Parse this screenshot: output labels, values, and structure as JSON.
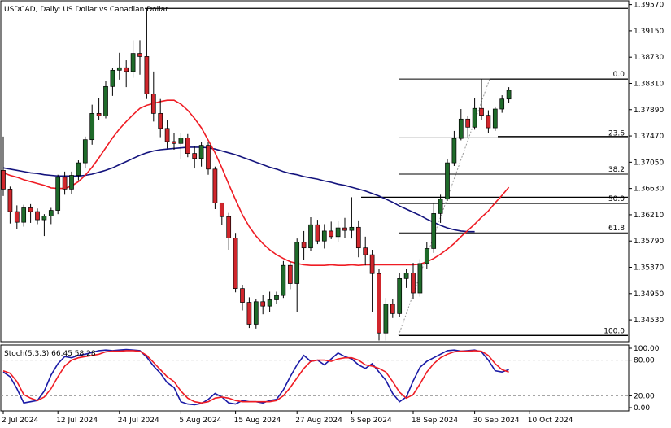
{
  "title": "USDCAD, Daily:  US Dollar vs Canadian Dollar",
  "indicator_title": "Stoch(5,3,3) 66.45 58.28",
  "colors": {
    "bull": "#1f6b2a",
    "bear": "#d0262c",
    "wick": "#000000",
    "ma_fast": "#ef1c24",
    "ma_slow": "#13137d",
    "stoch_main": "#1a1aa6",
    "stoch_signal": "#ef1c24",
    "fib": "#000000"
  },
  "chart_data": {
    "type": "candlestick",
    "symbol": "USDCAD",
    "timeframe": "Daily",
    "ylim": [
      1.3418,
      1.3963
    ],
    "y_ticks": [
      "1.39570",
      "1.39150",
      "1.38730",
      "1.38310",
      "1.37890",
      "1.37470",
      "1.37050",
      "1.36630",
      "1.36210",
      "1.35790",
      "1.35370",
      "1.34950",
      "1.34530"
    ],
    "x_tick_labels": [
      "2 Jul 2024",
      "12 Jul 2024",
      "24 Jul 2024",
      "5 Aug 2024",
      "15 Aug 2024",
      "27 Aug 2024",
      "6 Sep 2024",
      "18 Sep 2024",
      "30 Sep 2024",
      "10 Oct 2024"
    ],
    "candles": [
      {
        "o": 1.3692,
        "h": 1.3746,
        "l": 1.3651,
        "c": 1.3662
      },
      {
        "o": 1.3662,
        "h": 1.3666,
        "l": 1.3607,
        "c": 1.3626
      },
      {
        "o": 1.3626,
        "h": 1.3636,
        "l": 1.3598,
        "c": 1.3609
      },
      {
        "o": 1.3609,
        "h": 1.3637,
        "l": 1.3602,
        "c": 1.3632
      },
      {
        "o": 1.3632,
        "h": 1.3638,
        "l": 1.3608,
        "c": 1.3626
      },
      {
        "o": 1.3626,
        "h": 1.3631,
        "l": 1.3606,
        "c": 1.3613
      },
      {
        "o": 1.3613,
        "h": 1.3622,
        "l": 1.3587,
        "c": 1.3619
      },
      {
        "o": 1.3619,
        "h": 1.3632,
        "l": 1.3606,
        "c": 1.3628
      },
      {
        "o": 1.3628,
        "h": 1.3685,
        "l": 1.3622,
        "c": 1.3681
      },
      {
        "o": 1.3681,
        "h": 1.369,
        "l": 1.3653,
        "c": 1.3662
      },
      {
        "o": 1.3662,
        "h": 1.369,
        "l": 1.3654,
        "c": 1.3684
      },
      {
        "o": 1.3684,
        "h": 1.3708,
        "l": 1.3676,
        "c": 1.3704
      },
      {
        "o": 1.3704,
        "h": 1.3746,
        "l": 1.3695,
        "c": 1.3741
      },
      {
        "o": 1.3741,
        "h": 1.3797,
        "l": 1.3733,
        "c": 1.3783
      },
      {
        "o": 1.3783,
        "h": 1.3807,
        "l": 1.3772,
        "c": 1.3779
      },
      {
        "o": 1.3779,
        "h": 1.3835,
        "l": 1.3775,
        "c": 1.3826
      },
      {
        "o": 1.3826,
        "h": 1.3856,
        "l": 1.3811,
        "c": 1.3852
      },
      {
        "o": 1.3852,
        "h": 1.388,
        "l": 1.3837,
        "c": 1.3856
      },
      {
        "o": 1.3856,
        "h": 1.3868,
        "l": 1.3825,
        "c": 1.385
      },
      {
        "o": 1.385,
        "h": 1.39,
        "l": 1.384,
        "c": 1.3879
      },
      {
        "o": 1.3879,
        "h": 1.39,
        "l": 1.3845,
        "c": 1.3874
      },
      {
        "o": 1.3874,
        "h": 1.3951,
        "l": 1.3806,
        "c": 1.3814
      },
      {
        "o": 1.3814,
        "h": 1.385,
        "l": 1.377,
        "c": 1.3783
      },
      {
        "o": 1.3783,
        "h": 1.3806,
        "l": 1.3745,
        "c": 1.3759
      },
      {
        "o": 1.3759,
        "h": 1.3772,
        "l": 1.3727,
        "c": 1.3738
      },
      {
        "o": 1.3738,
        "h": 1.3751,
        "l": 1.3725,
        "c": 1.3735
      },
      {
        "o": 1.3735,
        "h": 1.3752,
        "l": 1.371,
        "c": 1.3744
      },
      {
        "o": 1.3744,
        "h": 1.375,
        "l": 1.3713,
        "c": 1.3719
      },
      {
        "o": 1.3719,
        "h": 1.373,
        "l": 1.3695,
        "c": 1.3711
      },
      {
        "o": 1.3711,
        "h": 1.3738,
        "l": 1.3698,
        "c": 1.3732
      },
      {
        "o": 1.3732,
        "h": 1.3737,
        "l": 1.3685,
        "c": 1.3694
      },
      {
        "o": 1.3694,
        "h": 1.3698,
        "l": 1.363,
        "c": 1.364
      },
      {
        "o": 1.364,
        "h": 1.364,
        "l": 1.3605,
        "c": 1.3618
      },
      {
        "o": 1.3618,
        "h": 1.3624,
        "l": 1.3565,
        "c": 1.3584
      },
      {
        "o": 1.3584,
        "h": 1.3592,
        "l": 1.3497,
        "c": 1.3503
      },
      {
        "o": 1.3503,
        "h": 1.3509,
        "l": 1.3468,
        "c": 1.3481
      },
      {
        "o": 1.3481,
        "h": 1.3489,
        "l": 1.344,
        "c": 1.3446
      },
      {
        "o": 1.3446,
        "h": 1.3486,
        "l": 1.3439,
        "c": 1.3482
      },
      {
        "o": 1.3482,
        "h": 1.3493,
        "l": 1.3462,
        "c": 1.3475
      },
      {
        "o": 1.3475,
        "h": 1.3498,
        "l": 1.3466,
        "c": 1.3485
      },
      {
        "o": 1.3485,
        "h": 1.3498,
        "l": 1.3478,
        "c": 1.3492
      },
      {
        "o": 1.3492,
        "h": 1.3547,
        "l": 1.3488,
        "c": 1.354
      },
      {
        "o": 1.354,
        "h": 1.3546,
        "l": 1.3502,
        "c": 1.3511
      },
      {
        "o": 1.3511,
        "h": 1.3583,
        "l": 1.3466,
        "c": 1.3577
      },
      {
        "o": 1.3577,
        "h": 1.3595,
        "l": 1.3549,
        "c": 1.3568
      },
      {
        "o": 1.3568,
        "h": 1.3617,
        "l": 1.3563,
        "c": 1.3605
      },
      {
        "o": 1.3605,
        "h": 1.3613,
        "l": 1.3574,
        "c": 1.3579
      },
      {
        "o": 1.3579,
        "h": 1.3606,
        "l": 1.3567,
        "c": 1.3595
      },
      {
        "o": 1.3595,
        "h": 1.361,
        "l": 1.3582,
        "c": 1.3586
      },
      {
        "o": 1.3586,
        "h": 1.3611,
        "l": 1.3577,
        "c": 1.36
      },
      {
        "o": 1.36,
        "h": 1.3616,
        "l": 1.3584,
        "c": 1.3596
      },
      {
        "o": 1.3596,
        "h": 1.3649,
        "l": 1.3583,
        "c": 1.3601
      },
      {
        "o": 1.3601,
        "h": 1.3612,
        "l": 1.3553,
        "c": 1.3568
      },
      {
        "o": 1.3568,
        "h": 1.3586,
        "l": 1.354,
        "c": 1.3557
      },
      {
        "o": 1.3557,
        "h": 1.3565,
        "l": 1.3465,
        "c": 1.3527
      },
      {
        "o": 1.3527,
        "h": 1.3535,
        "l": 1.342,
        "c": 1.3432
      },
      {
        "o": 1.3432,
        "h": 1.3488,
        "l": 1.342,
        "c": 1.3478
      },
      {
        "o": 1.3478,
        "h": 1.3486,
        "l": 1.3456,
        "c": 1.3463
      },
      {
        "o": 1.3463,
        "h": 1.3528,
        "l": 1.3458,
        "c": 1.3519
      },
      {
        "o": 1.3519,
        "h": 1.3535,
        "l": 1.3504,
        "c": 1.3528
      },
      {
        "o": 1.3528,
        "h": 1.3544,
        "l": 1.3486,
        "c": 1.3496
      },
      {
        "o": 1.3496,
        "h": 1.355,
        "l": 1.349,
        "c": 1.3543
      },
      {
        "o": 1.3543,
        "h": 1.3577,
        "l": 1.3535,
        "c": 1.3567
      },
      {
        "o": 1.3567,
        "h": 1.3639,
        "l": 1.356,
        "c": 1.3623
      },
      {
        "o": 1.3623,
        "h": 1.3653,
        "l": 1.3608,
        "c": 1.3646
      },
      {
        "o": 1.3646,
        "h": 1.371,
        "l": 1.3643,
        "c": 1.3704
      },
      {
        "o": 1.3704,
        "h": 1.3755,
        "l": 1.3699,
        "c": 1.3743
      },
      {
        "o": 1.3743,
        "h": 1.379,
        "l": 1.374,
        "c": 1.3774
      },
      {
        "o": 1.3774,
        "h": 1.3779,
        "l": 1.3745,
        "c": 1.3761
      },
      {
        "o": 1.3761,
        "h": 1.3808,
        "l": 1.3757,
        "c": 1.3791
      },
      {
        "o": 1.3791,
        "h": 1.3838,
        "l": 1.3773,
        "c": 1.378
      },
      {
        "o": 1.378,
        "h": 1.3788,
        "l": 1.3751,
        "c": 1.376
      },
      {
        "o": 1.376,
        "h": 1.3794,
        "l": 1.3755,
        "c": 1.379
      },
      {
        "o": 1.379,
        "h": 1.3812,
        "l": 1.3784,
        "c": 1.3806
      },
      {
        "o": 1.3806,
        "h": 1.3825,
        "l": 1.38,
        "c": 1.382
      }
    ],
    "ma_fast": [
      1.3688,
      1.3684,
      1.3681,
      1.3677,
      1.3674,
      1.3671,
      1.3668,
      1.3664,
      1.3663,
      1.3663,
      1.3667,
      1.3674,
      1.3684,
      1.3697,
      1.3712,
      1.3728,
      1.3744,
      1.3758,
      1.377,
      1.3781,
      1.3791,
      1.3796,
      1.3799,
      1.3802,
      1.3804,
      1.3804,
      1.3798,
      1.3788,
      1.3775,
      1.376,
      1.374,
      1.372,
      1.3696,
      1.367,
      1.3645,
      1.3621,
      1.3602,
      1.3587,
      1.3575,
      1.3565,
      1.3557,
      1.3551,
      1.3546,
      1.3543,
      1.3541,
      1.354,
      1.354,
      1.354,
      1.3541,
      1.354,
      1.354,
      1.3541,
      1.354,
      1.3541,
      1.3541,
      1.3541,
      1.3541,
      1.3541,
      1.3541,
      1.3541,
      1.3541,
      1.3542,
      1.3546,
      1.3551,
      1.3558,
      1.3566,
      1.3575,
      1.3586,
      1.3596,
      1.3606,
      1.3617,
      1.3627,
      1.364,
      1.3652,
      1.3665
    ],
    "ma_slow": [
      1.3696,
      1.3694,
      1.3692,
      1.369,
      1.3688,
      1.3687,
      1.3685,
      1.3684,
      1.3683,
      1.3683,
      1.3683,
      1.3683,
      1.3684,
      1.3686,
      1.3689,
      1.3692,
      1.3696,
      1.3701,
      1.3706,
      1.3711,
      1.3716,
      1.372,
      1.3723,
      1.3725,
      1.3726,
      1.3727,
      1.3728,
      1.3729,
      1.3729,
      1.3729,
      1.3728,
      1.3726,
      1.3723,
      1.372,
      1.3717,
      1.3713,
      1.3709,
      1.3705,
      1.3701,
      1.3697,
      1.3694,
      1.369,
      1.3687,
      1.3685,
      1.3682,
      1.368,
      1.3678,
      1.3675,
      1.3673,
      1.367,
      1.3668,
      1.3665,
      1.3662,
      1.3659,
      1.3655,
      1.3651,
      1.3646,
      1.3641,
      1.3635,
      1.363,
      1.3625,
      1.362,
      1.3614,
      1.3609,
      1.3604,
      1.36,
      1.3597,
      1.3595,
      1.3594,
      1.3594,
      1.3594,
      1.3595,
      1.3596,
      1.3597,
      1.3598
    ],
    "ma_slow_end": 70,
    "fibonacci": [
      {
        "label": "0.0",
        "price": 1.3838
      },
      {
        "label": "23.6",
        "price": 1.3744
      },
      {
        "label": "38.2",
        "price": 1.3686
      },
      {
        "label": "50.0",
        "price": 1.3639
      },
      {
        "label": "61.8",
        "price": 1.3592
      },
      {
        "label": "100.0",
        "price": 1.3428
      }
    ],
    "stoch_ylim": [
      0,
      100
    ],
    "stoch_ticks": [
      "100.00",
      "80.00",
      "20.00",
      "0.00"
    ],
    "stoch_levels": [
      80,
      20
    ],
    "stoch_main": [
      60,
      52,
      32,
      8,
      10,
      12,
      28,
      55,
      74,
      86,
      84,
      88,
      90,
      93,
      96,
      97,
      96,
      97,
      98,
      97,
      96,
      85,
      70,
      58,
      42,
      34,
      10,
      6,
      5,
      7,
      14,
      24,
      18,
      8,
      6,
      12,
      10,
      10,
      8,
      12,
      14,
      30,
      52,
      72,
      88,
      78,
      80,
      72,
      82,
      92,
      86,
      82,
      72,
      66,
      74,
      60,
      46,
      24,
      10,
      18,
      45,
      68,
      78,
      84,
      90,
      96,
      97,
      95,
      96,
      97,
      94,
      80,
      62,
      60,
      64
    ],
    "stoch_signal": [
      62,
      58,
      44,
      22,
      16,
      12,
      18,
      32,
      52,
      70,
      80,
      84,
      86,
      88,
      90,
      94,
      95,
      95,
      96,
      96,
      95,
      88,
      76,
      64,
      52,
      44,
      28,
      16,
      10,
      8,
      10,
      16,
      18,
      16,
      12,
      10,
      10,
      10,
      10,
      10,
      12,
      20,
      34,
      50,
      66,
      78,
      80,
      80,
      78,
      82,
      84,
      84,
      80,
      72,
      70,
      66,
      60,
      44,
      26,
      16,
      22,
      40,
      60,
      74,
      84,
      90,
      94,
      95,
      95,
      96,
      95,
      88,
      74,
      64,
      60
    ]
  }
}
